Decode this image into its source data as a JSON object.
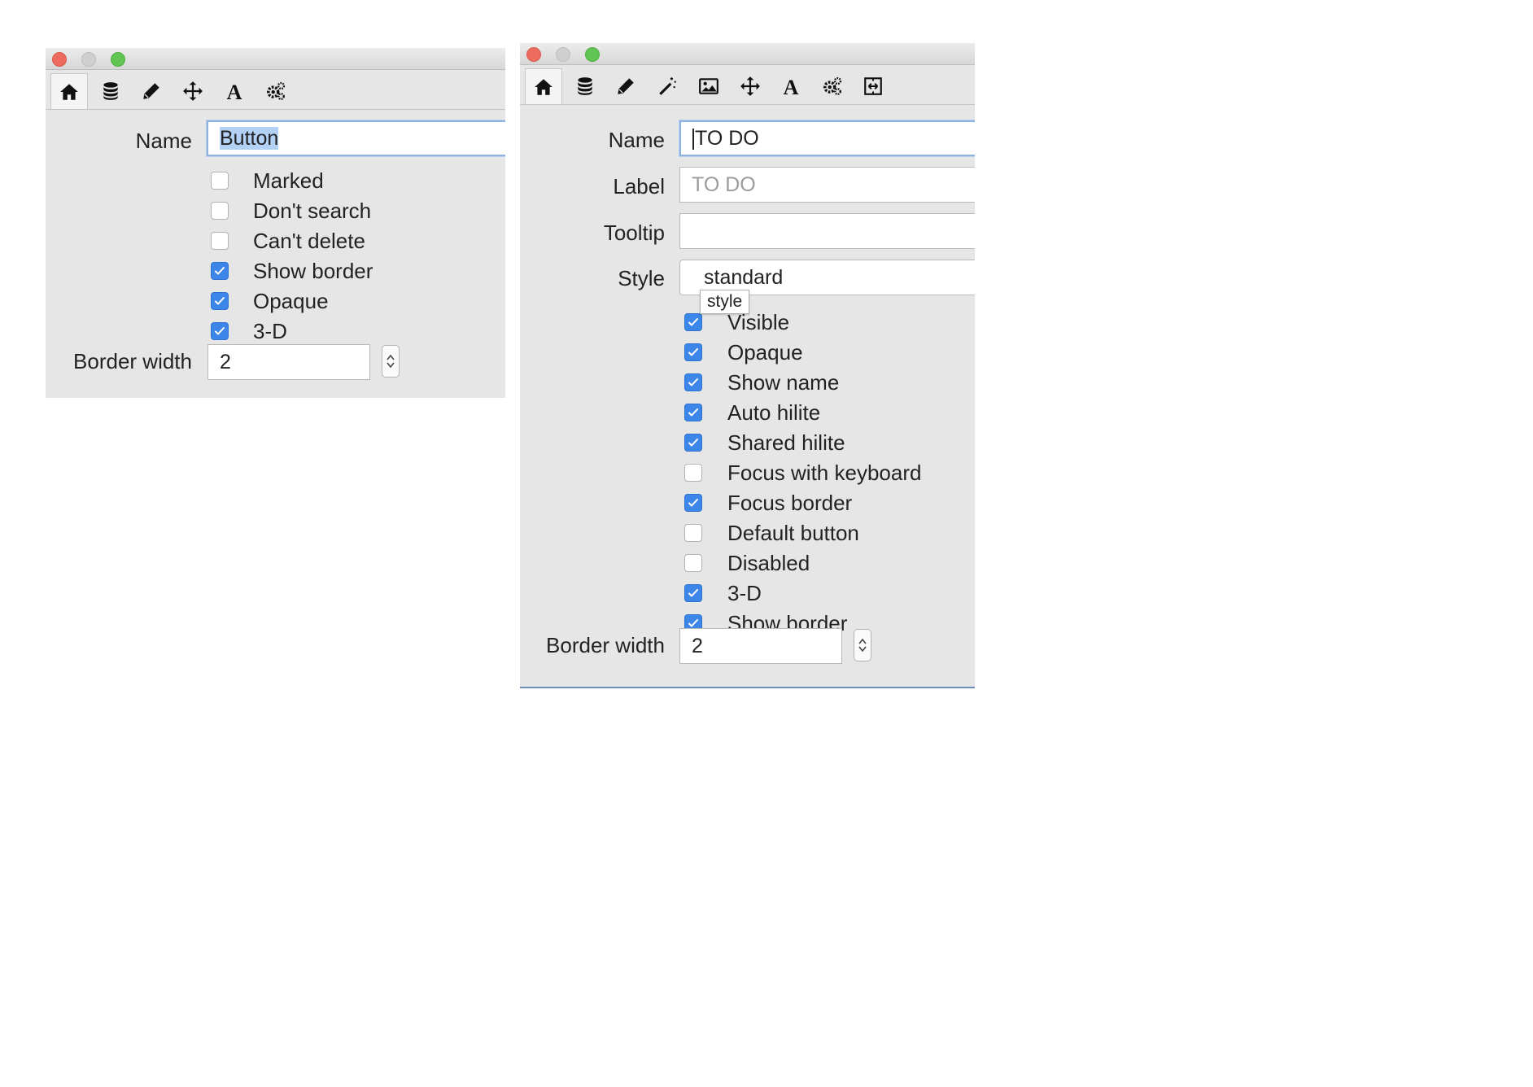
{
  "window_a": {
    "name_label": "Name",
    "name_value": "Button",
    "checkboxes": [
      {
        "label": "Marked",
        "checked": false
      },
      {
        "label": "Don't search",
        "checked": false
      },
      {
        "label": "Can't delete",
        "checked": false
      },
      {
        "label": "Show border",
        "checked": true
      },
      {
        "label": "Opaque",
        "checked": true
      },
      {
        "label": "3-D",
        "checked": true
      }
    ],
    "border_width_label": "Border width",
    "border_width_value": "2"
  },
  "window_b": {
    "name_label": "Name",
    "name_value": "TO DO",
    "label_label": "Label",
    "label_placeholder": "TO DO",
    "tooltip_label": "Tooltip",
    "tooltip_value": "",
    "style_label": "Style",
    "style_value": "standard",
    "tooltip_popup": "style",
    "checkboxes": [
      {
        "label": "Visible",
        "checked": true
      },
      {
        "label": "Opaque",
        "checked": true
      },
      {
        "label": "Show name",
        "checked": true
      },
      {
        "label": "Auto hilite",
        "checked": true
      },
      {
        "label": "Shared hilite",
        "checked": true
      },
      {
        "label": "Focus with keyboard",
        "checked": false
      },
      {
        "label": "Focus border",
        "checked": true
      },
      {
        "label": "Default button",
        "checked": false
      },
      {
        "label": "Disabled",
        "checked": false
      },
      {
        "label": "3-D",
        "checked": true
      },
      {
        "label": "Show border",
        "checked": true
      }
    ],
    "border_width_label": "Border width",
    "border_width_value": "2"
  },
  "toolbar_a_icons": [
    "home-icon",
    "database-icon",
    "pencil-icon",
    "move-icon",
    "font-icon",
    "gears-icon"
  ],
  "toolbar_b_icons": [
    "home-icon",
    "database-icon",
    "pencil-icon",
    "magic-wand-icon",
    "image-icon",
    "move-icon",
    "font-icon",
    "gears-icon",
    "resize-icon"
  ],
  "colors": {
    "checkbox_checked": "#3b86e8",
    "selection": "#b3d1f5",
    "focus_ring": "#8fb1dd",
    "panel_bg": "#e6e6e6"
  }
}
